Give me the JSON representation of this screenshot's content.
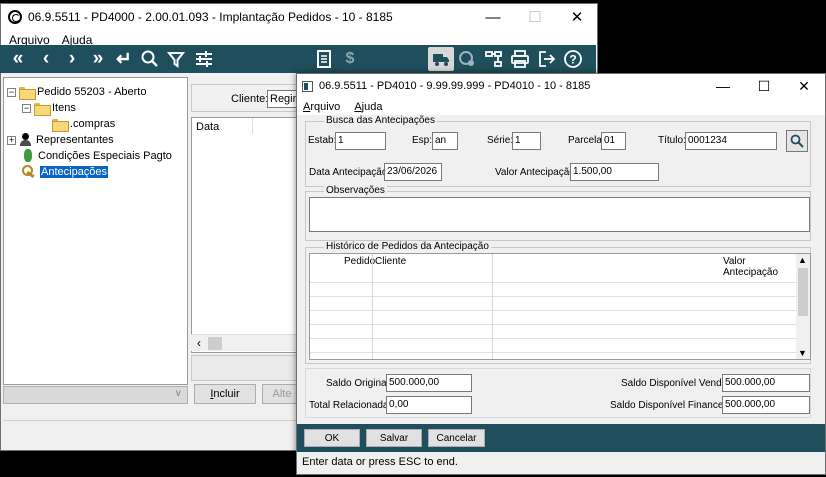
{
  "main_window": {
    "title": "06.9.5511 - PD4000 - 2.00.01.093 - Implantação Pedidos - 10 - 8185",
    "menu": [
      "Arquivo",
      "Ajuda"
    ],
    "tree": {
      "root": "Pedido 55203 - Aberto",
      "itens": "Itens",
      "compras": ".compras",
      "representantes": "Representantes",
      "condicoes": "Condições Especiais Pagto",
      "antecipacoes": "Antecipações"
    },
    "client_label": "Cliente:",
    "client_value": "Regin",
    "grid_col_date": "Data",
    "buttons": {
      "incluir": "Incluir",
      "alterar": "Alte"
    }
  },
  "dialog": {
    "title": "06.9.5511 - PD4010 - 9.99.99.999 - PD4010 - 10 - 8185",
    "menu": [
      "Arquivo",
      "Ajuda"
    ],
    "busca": {
      "legend": "Busca das Antecipações",
      "estab_label": "Estab:",
      "estab_value": "1",
      "esp_label": "Esp:",
      "esp_value": "an",
      "serie_label": "Série:",
      "serie_value": "1",
      "parcela_label": "Parcela:",
      "parcela_value": "01",
      "titulo_label": "Título:",
      "titulo_value": "0001234",
      "data_label": "Data Antecipação:",
      "data_value": "23/06/2026",
      "valor_label": "Valor Antecipação:",
      "valor_value": "1.500,00"
    },
    "observacoes_legend": "Observações",
    "historico": {
      "legend": "Histórico de Pedidos da Antecipação",
      "columns": [
        "Pedido",
        "Cliente",
        "Valor Antecipação"
      ]
    },
    "totals": {
      "saldo_original_label": "Saldo Original:",
      "saldo_original_value": "500.000,00",
      "total_relacionada_label": "Total Relacionada:",
      "total_relacionada_value": "0,00",
      "saldo_vendas_label": "Saldo Disponível Vendas:",
      "saldo_vendas_value": "500.000,00",
      "saldo_financeiro_label": "Saldo Disponível Financeiro:",
      "saldo_financeiro_value": "500.000,00"
    },
    "buttons": {
      "ok": "OK",
      "salvar": "Salvar",
      "cancelar": "Cancelar"
    },
    "status": "Enter data or press ESC to end."
  },
  "colors": {
    "toolbar": "#1f4e5d",
    "selection": "#0a64c8"
  }
}
